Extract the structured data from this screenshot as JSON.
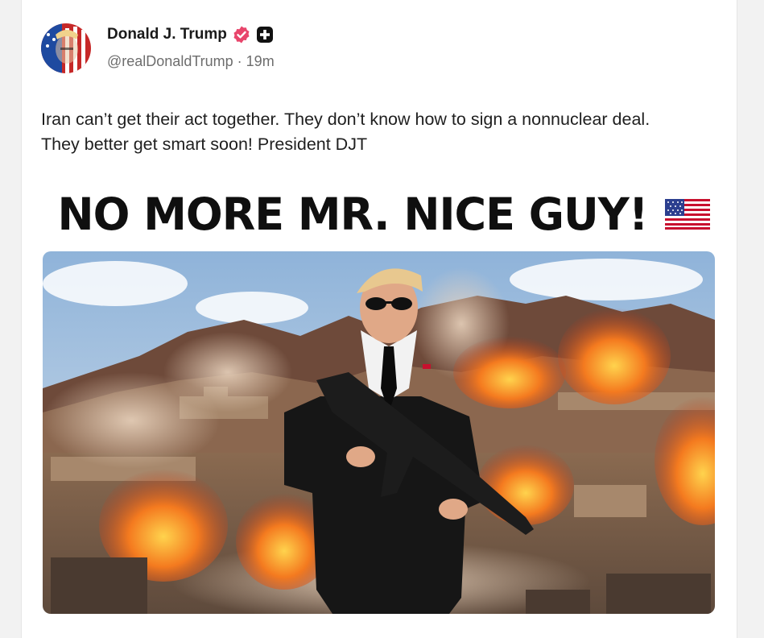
{
  "post": {
    "author": {
      "display_name": "Donald J. Trump",
      "handle": "@realDonaldTrump",
      "time_ago": "19m",
      "separator": " · ",
      "verified_icon": "verified-badge-icon",
      "extra_badge_icon": "plus-badge-icon"
    },
    "text": "Iran can’t get their act together. They don’t know how to sign a nonnuclear deal. They better get smart soon! President DJT",
    "media": {
      "headline": "NO MORE MR. NICE GUY!",
      "headline_emoji": "us-flag-icon",
      "image_subject": "man-in-suit-with-rifle-explosions"
    }
  },
  "colors": {
    "verified_badge": "#e8456b",
    "text_primary": "#1f1f1f",
    "text_secondary": "#6d6d6d"
  }
}
